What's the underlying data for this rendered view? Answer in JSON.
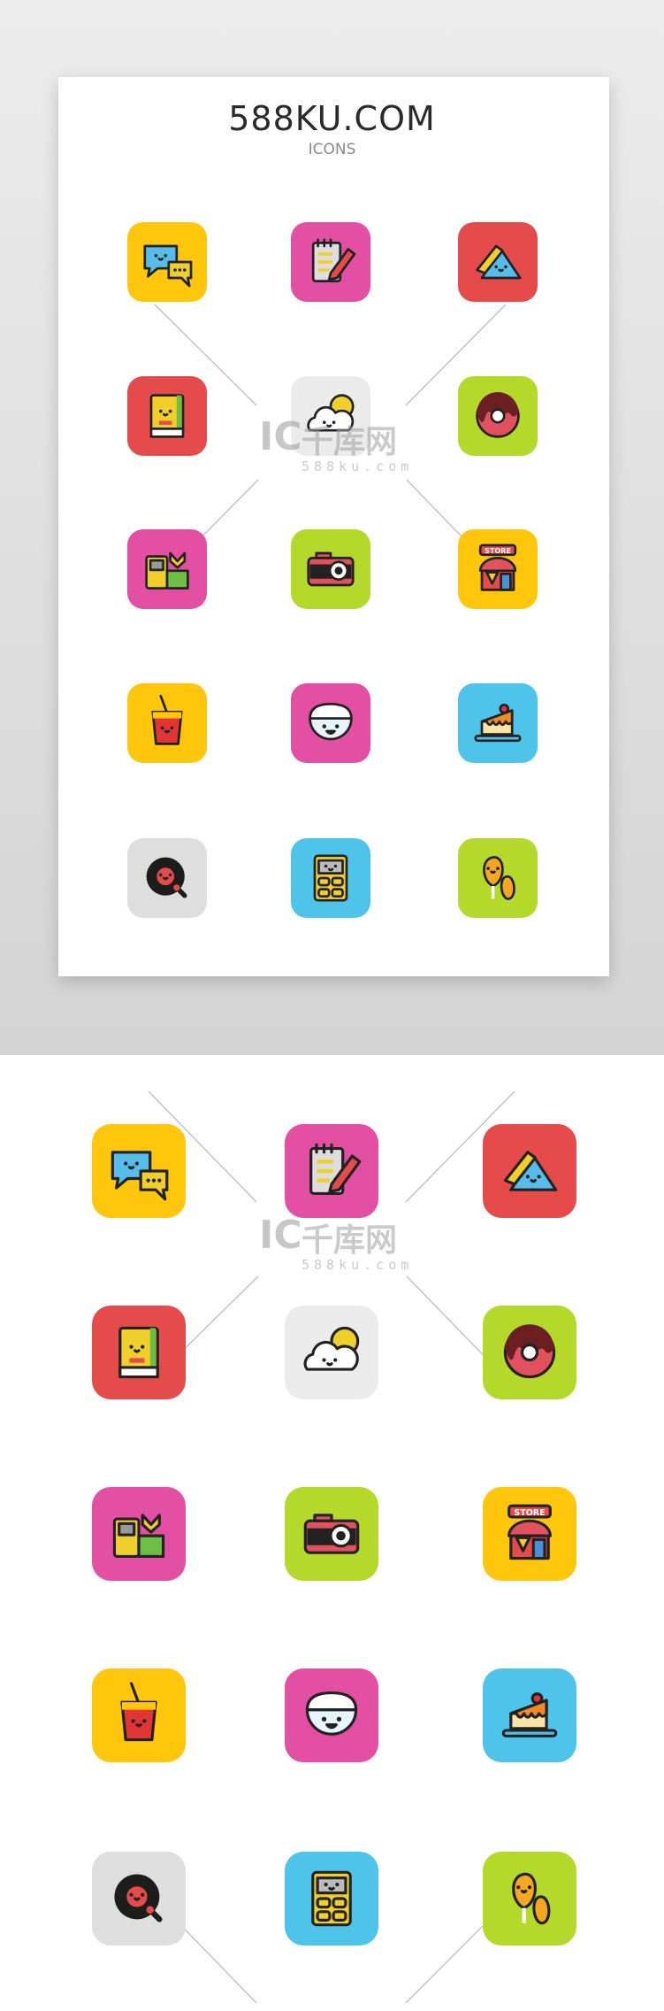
{
  "header": {
    "title": "588KU.COM",
    "subtitle": "ICONS"
  },
  "watermark": {
    "logo": "IC",
    "text": "千库网",
    "url": "588ku.com"
  },
  "colors": {
    "yellow": "#FFC60B",
    "pink": "#E24FA3",
    "red": "#E54B4B",
    "lightgray": "#EBEBEB",
    "green": "#B5D92B",
    "blue": "#4FC4EA",
    "gray": "#DEDEDE"
  },
  "icons": [
    {
      "name": "chat-bubbles-icon",
      "bg": "#FFC60B"
    },
    {
      "name": "notepad-marker-icon",
      "bg": "#E24FA3"
    },
    {
      "name": "telephone-icon",
      "bg": "#E54B4B"
    },
    {
      "name": "notebook-icon",
      "bg": "#E54B4B"
    },
    {
      "name": "cloud-sun-icon",
      "bg": "#EBEBEB"
    },
    {
      "name": "donut-icon",
      "bg": "#B5D92B"
    },
    {
      "name": "gameboy-plant-icon",
      "bg": "#E24FA3"
    },
    {
      "name": "camera-icon",
      "bg": "#B5D92B"
    },
    {
      "name": "store-icon",
      "bg": "#FFC60B"
    },
    {
      "name": "drink-cup-icon",
      "bg": "#FFC60B"
    },
    {
      "name": "rice-bowl-icon",
      "bg": "#E24FA3"
    },
    {
      "name": "cake-slice-icon",
      "bg": "#4FC4EA"
    },
    {
      "name": "vinyl-record-icon",
      "bg": "#DEDEDE"
    },
    {
      "name": "calculator-icon",
      "bg": "#4FC4EA"
    },
    {
      "name": "chicken-drumstick-icon",
      "bg": "#B5D92B"
    }
  ],
  "store_sign": "STORE"
}
